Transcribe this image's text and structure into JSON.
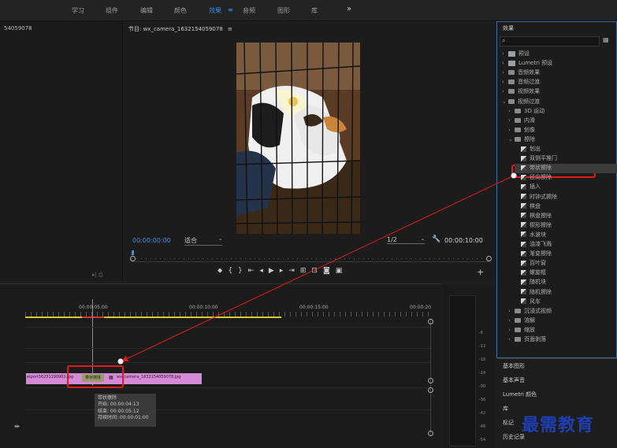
{
  "workspace_tabs": [
    "学习",
    "组件",
    "编辑",
    "颜色",
    "效果",
    "音频",
    "图形",
    "库"
  ],
  "active_tab": "效果",
  "workspace_menu_icon": "hamburger-icon",
  "more_icon": "»",
  "source_panel": {
    "title_fragment": "54059078"
  },
  "program_monitor": {
    "title": "节目: wx_camera_1632154059078",
    "menu": "≡",
    "current_time": "00:00:00:00",
    "fit": "适合",
    "resolution": "1/2",
    "duration": "00:00:10:00"
  },
  "effects_panel": {
    "title": "效果",
    "menu": "≡",
    "search_placeholder": "",
    "items": [
      {
        "label": "预设",
        "level": 0,
        "type": "preset-folder",
        "expanded": false
      },
      {
        "label": "Lumetri 预设",
        "level": 0,
        "type": "preset-folder",
        "expanded": false
      },
      {
        "label": "音频效果",
        "level": 0,
        "type": "folder",
        "expanded": false
      },
      {
        "label": "音频过渡",
        "level": 0,
        "type": "folder",
        "expanded": false
      },
      {
        "label": "视频效果",
        "level": 0,
        "type": "folder",
        "expanded": false
      },
      {
        "label": "视频过渡",
        "level": 0,
        "type": "folder",
        "expanded": true
      },
      {
        "label": "3D 运动",
        "level": 1,
        "type": "folder",
        "expanded": false
      },
      {
        "label": "内滑",
        "level": 1,
        "type": "folder",
        "expanded": false
      },
      {
        "label": "划像",
        "level": 1,
        "type": "folder",
        "expanded": false
      },
      {
        "label": "擦除",
        "level": 1,
        "type": "folder",
        "expanded": true
      },
      {
        "label": "划出",
        "level": 2,
        "type": "effect"
      },
      {
        "label": "双侧平推门",
        "level": 2,
        "type": "effect"
      },
      {
        "label": "带状擦除",
        "level": 2,
        "type": "effect",
        "selected": true
      },
      {
        "label": "径向擦除",
        "level": 2,
        "type": "effect"
      },
      {
        "label": "插入",
        "level": 2,
        "type": "effect"
      },
      {
        "label": "时钟式擦除",
        "level": 2,
        "type": "effect"
      },
      {
        "label": "棋盘",
        "level": 2,
        "type": "effect"
      },
      {
        "label": "棋盘擦除",
        "level": 2,
        "type": "effect"
      },
      {
        "label": "楔形擦除",
        "level": 2,
        "type": "effect"
      },
      {
        "label": "水波块",
        "level": 2,
        "type": "effect"
      },
      {
        "label": "油漆飞溅",
        "level": 2,
        "type": "effect"
      },
      {
        "label": "渐变擦除",
        "level": 2,
        "type": "effect"
      },
      {
        "label": "百叶窗",
        "level": 2,
        "type": "effect"
      },
      {
        "label": "螺旋框",
        "level": 2,
        "type": "effect"
      },
      {
        "label": "随机块",
        "level": 2,
        "type": "effect"
      },
      {
        "label": "随机擦除",
        "level": 2,
        "type": "effect"
      },
      {
        "label": "风车",
        "level": 2,
        "type": "effect"
      },
      {
        "label": "沉浸式视频",
        "level": 1,
        "type": "folder",
        "expanded": false
      },
      {
        "label": "溶解",
        "level": 1,
        "type": "folder",
        "expanded": false
      },
      {
        "label": "缩放",
        "level": 1,
        "type": "folder",
        "expanded": false
      },
      {
        "label": "页面剥落",
        "level": 1,
        "type": "folder",
        "expanded": false
      }
    ]
  },
  "lower_panels": [
    "基本图形",
    "基本声音",
    "Lumetri 颜色",
    "库",
    "标记",
    "历史记录"
  ],
  "timeline": {
    "ruler_labels": [
      "00:00:05:00",
      "00:00:10:00",
      "00:00:15:00",
      "00:00:20"
    ],
    "clip_left": "eiport16231190961.jpg",
    "clip_right": "wx_camera_1632154059078.jpg",
    "transition_label": "带状擦除",
    "tooltip": {
      "name": "带状擦除",
      "start": "开始: 00:00:04:13",
      "end": "结束: 00:00:05:12",
      "duration": "持续时间: 00:00:01:00"
    }
  },
  "meter_labels": [
    "-6",
    "-12",
    "-18",
    "-24",
    "-30",
    "-36",
    "-42",
    "-48",
    "-54"
  ],
  "watermark": "最需教育",
  "colors": {
    "accent": "#2d8ceb",
    "annotation": "#e21a1a",
    "clip": "#d58ad6",
    "watermark": "#1f3fb0"
  }
}
